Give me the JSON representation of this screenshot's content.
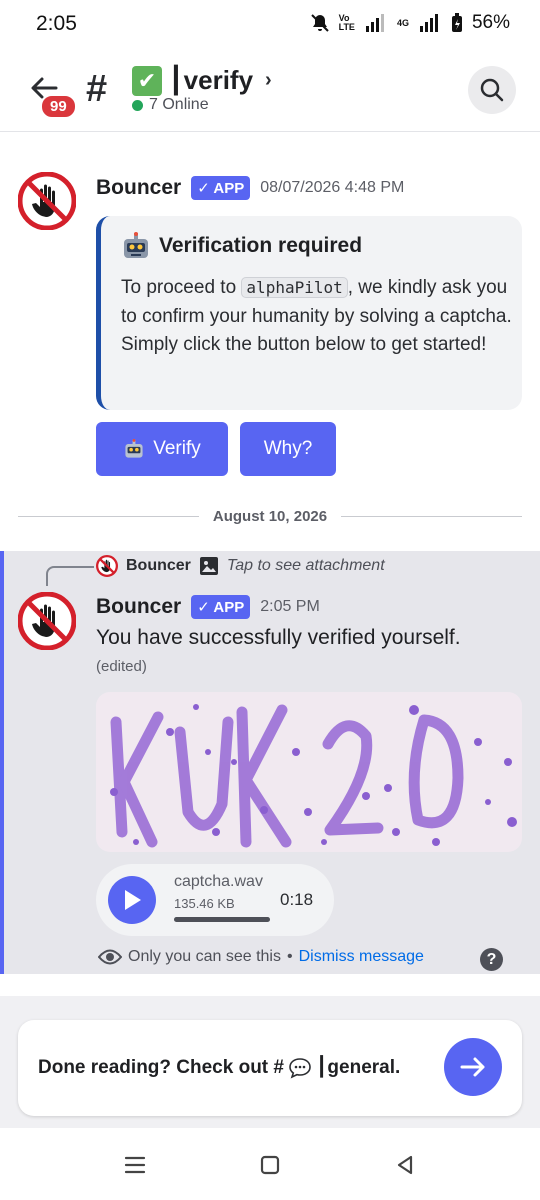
{
  "status_bar": {
    "time": "2:05",
    "network_label": "4G",
    "battery_pct": "56%"
  },
  "header": {
    "unread_badge": "99",
    "channel_name": "┃verify",
    "online_count": "7 Online"
  },
  "message1": {
    "author": "Bouncer",
    "app_tag": "✓ APP",
    "timestamp": "08/07/2026 4:48 PM",
    "embed": {
      "title": "Verification required",
      "desc_before": "To proceed to ",
      "code": "alphaPilot",
      "desc_after": ", we kindly ask you to confirm your humanity by solving a captcha. Simply click the button below to get started!",
      "accent_color": "#1e4fa8"
    },
    "buttons": {
      "verify_label": "Verify",
      "why_label": "Why?"
    }
  },
  "date_divider": "August 10, 2026",
  "message2": {
    "reply": {
      "author": "Bouncer",
      "attachment_text": "Tap to see attachment"
    },
    "author": "Bouncer",
    "app_tag": "✓ APP",
    "timestamp": "2:05 PM",
    "text": "You have successfully verified yourself.",
    "edited": "(edited)",
    "captcha_image_text": "KUK2D",
    "audio": {
      "filename": "captcha.wav",
      "size": "135.46 KB",
      "duration": "0:18",
      "progress": 1.0
    },
    "ephemeral_note": "Only you can see this",
    "separator": "•",
    "dismiss_label": "Dismiss message"
  },
  "composer": {
    "prompt": "Done reading? Check out #",
    "channel": "┃general."
  },
  "colors": {
    "blurple": "#5865f2",
    "danger": "#da373c",
    "online": "#23a55a",
    "link": "#006ce7"
  }
}
